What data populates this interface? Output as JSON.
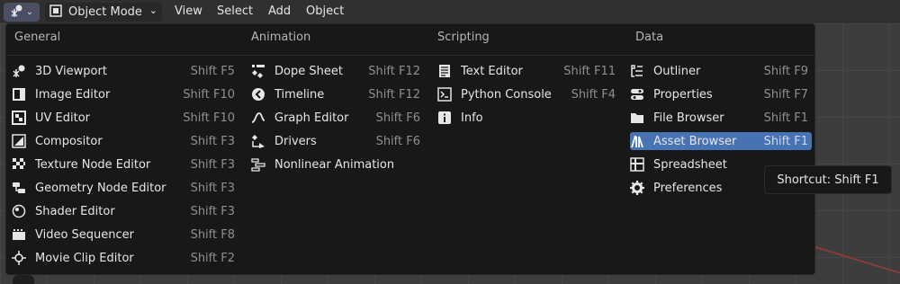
{
  "topbar": {
    "mode_label": "Object Mode",
    "menus": [
      "View",
      "Select",
      "Add",
      "Object"
    ]
  },
  "popup": {
    "columns": [
      {
        "header": "General",
        "items": [
          {
            "label": "3D Viewport",
            "shortcut": "Shift F5",
            "icon": "viewport-3d-icon"
          },
          {
            "label": "Image Editor",
            "shortcut": "Shift F10",
            "icon": "image-editor-icon"
          },
          {
            "label": "UV Editor",
            "shortcut": "Shift F10",
            "icon": "uv-editor-icon"
          },
          {
            "label": "Compositor",
            "shortcut": "Shift F3",
            "icon": "compositor-icon"
          },
          {
            "label": "Texture Node Editor",
            "shortcut": "Shift F3",
            "icon": "texture-node-icon"
          },
          {
            "label": "Geometry Node Editor",
            "shortcut": "Shift F3",
            "icon": "geometry-node-icon"
          },
          {
            "label": "Shader Editor",
            "shortcut": "Shift F3",
            "icon": "shader-editor-icon"
          },
          {
            "label": "Video Sequencer",
            "shortcut": "Shift F8",
            "icon": "video-sequencer-icon"
          },
          {
            "label": "Movie Clip Editor",
            "shortcut": "Shift F2",
            "icon": "movie-clip-icon"
          }
        ]
      },
      {
        "header": "Animation",
        "items": [
          {
            "label": "Dope Sheet",
            "shortcut": "Shift F12",
            "icon": "dope-sheet-icon"
          },
          {
            "label": "Timeline",
            "shortcut": "Shift F12",
            "icon": "timeline-icon"
          },
          {
            "label": "Graph Editor",
            "shortcut": "Shift F6",
            "icon": "graph-editor-icon"
          },
          {
            "label": "Drivers",
            "shortcut": "Shift F6",
            "icon": "drivers-icon"
          },
          {
            "label": "Nonlinear Animation",
            "shortcut": "",
            "icon": "nla-icon"
          }
        ]
      },
      {
        "header": "Scripting",
        "items": [
          {
            "label": "Text Editor",
            "shortcut": "Shift F11",
            "icon": "text-editor-icon"
          },
          {
            "label": "Python Console",
            "shortcut": "Shift F4",
            "icon": "python-console-icon"
          },
          {
            "label": "Info",
            "shortcut": "",
            "icon": "info-icon"
          }
        ]
      },
      {
        "header": "Data",
        "items": [
          {
            "label": "Outliner",
            "shortcut": "Shift F9",
            "icon": "outliner-icon"
          },
          {
            "label": "Properties",
            "shortcut": "Shift F7",
            "icon": "properties-icon"
          },
          {
            "label": "File Browser",
            "shortcut": "Shift F1",
            "icon": "folder-icon"
          },
          {
            "label": "Asset Browser",
            "shortcut": "Shift F1",
            "icon": "asset-browser-icon"
          },
          {
            "label": "Spreadsheet",
            "shortcut": "",
            "icon": "spreadsheet-icon"
          },
          {
            "label": "Preferences",
            "shortcut": "",
            "icon": "gear-icon"
          }
        ]
      }
    ],
    "highlighted": "Asset Browser",
    "highlight_color": "#4772b3"
  },
  "tooltip": {
    "text": "Shortcut: Shift F1"
  }
}
